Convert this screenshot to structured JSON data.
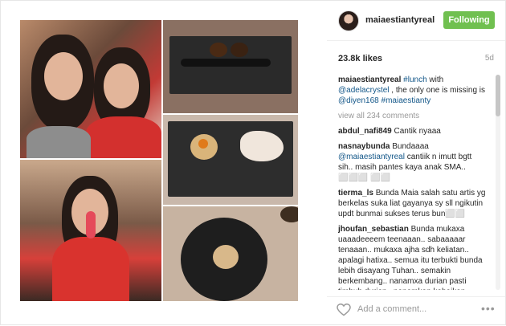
{
  "post": {
    "username": "maiaestiantyreal",
    "follow_label": "Following",
    "likes": "23.8k likes",
    "age": "5d",
    "caption_user": "maiaestiantyreal",
    "caption_parts": [
      "#lunch",
      " with ",
      "@adelacrystel",
      " , the only one is missing is ",
      "@diyen168",
      " ",
      "#maiaestianty"
    ],
    "view_all": "view all 234 comments"
  },
  "comments": [
    {
      "user": "abdul_nafi849",
      "text": "Cantik nyaaa"
    },
    {
      "user": "nasnaybunda",
      "text": "Bundaaaa",
      "mention": "@maiaestiantyreal",
      "text2": " cantiik n imutt bgtt sih.. masih pantes kaya anak SMA.. ⬜⬜⬜ ⬜⬜"
    },
    {
      "user": "tierma_ls",
      "text": "Bunda Maia salah satu artis yg berkelas suka liat gayanya sy sll ngikutin updt bunmai sukses terus bun⬜⬜"
    },
    {
      "user": "jhoufan_sebastian",
      "text": "Bunda mukaxa uaaadeeeem teenaaan.. sabaaaaar tenaaan.. mukaxa ajha sdh keliatan.. apalagi hatixa.. semua itu terbukti bunda lebih disayang Tuhan.. semakin berkembang.. nanamxa durian pasti timbuh durian.. nanamkan kebaikan.. kesabaran yg lapang.. pasti Berlatxa juga"
    }
  ],
  "footer": {
    "placeholder": "Add a comment...",
    "more": "•••"
  },
  "icons": {
    "heart": "heart-icon",
    "more": "more-options-icon"
  },
  "colors": {
    "follow_button": "#70c050",
    "link": "#125688"
  }
}
